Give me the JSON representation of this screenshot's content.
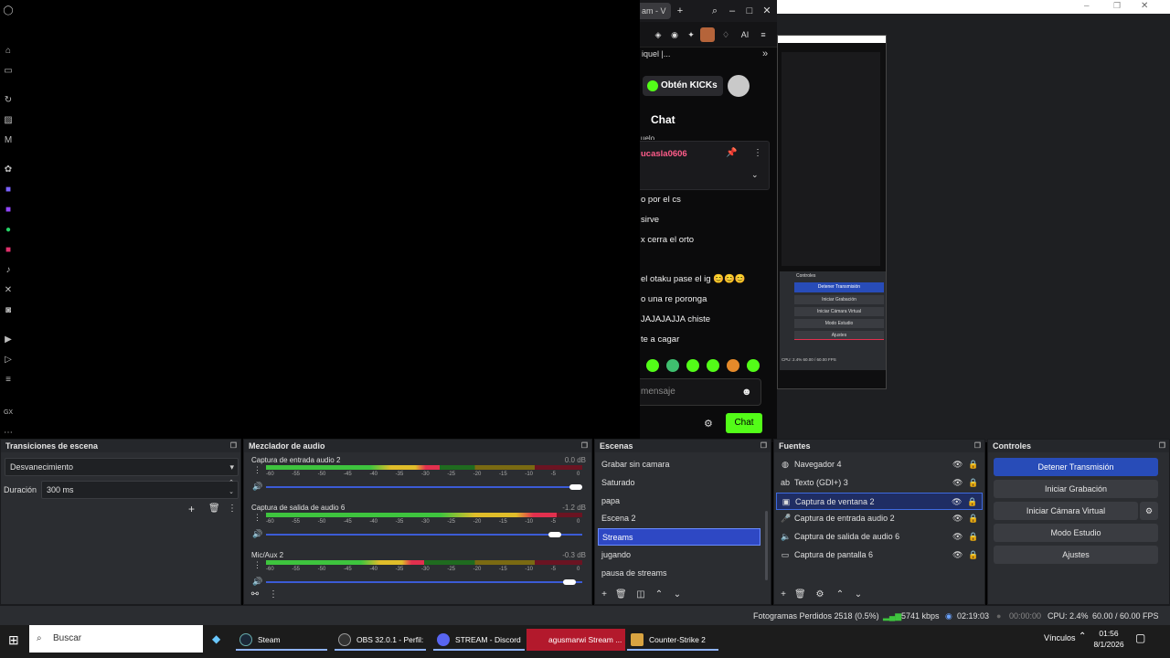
{
  "browser": {
    "tab_title": "am - V",
    "channel_header": "iquel |...",
    "kicks_button": "Obtén KICKs",
    "chat_title": "Chat",
    "partial_line": "uelo",
    "pinned_user": "ucasla0606",
    "messages": [
      "o por el cs",
      "sirve",
      "x cerra el orto",
      "el otaku pase el ig 😊😊😊",
      "o una re poronga",
      "JAJAJAJJA chiste",
      "te a cagar"
    ],
    "input_placeholder": "mensaje",
    "chat_send": "Chat",
    "toolbar_ai": "AI"
  },
  "preview": {
    "controles": "Controles",
    "btns": [
      "Detener Transmisión",
      "Iniciar Grabación",
      "Iniciar Cámara Virtual",
      "Modo Estudio",
      "Ajustes"
    ],
    "status": "CPU: 2.4%   60.00 / 60.00 FPS",
    "date": "01:56 8/1/2026",
    "vinculos": "Vínculos"
  },
  "transitions": {
    "title": "Transiciones de escena",
    "selected": "Desvanecimiento",
    "duration_label": "Duración",
    "duration_value": "300 ms"
  },
  "mixer": {
    "title": "Mezclador de audio",
    "scale": [
      "-60",
      "-55",
      "-50",
      "-45",
      "-40",
      "-35",
      "-30",
      "-25",
      "-20",
      "-15",
      "-10",
      "-5",
      "0"
    ],
    "tracks": [
      {
        "name": "Captura de entrada audio 2",
        "db": "0.0 dB",
        "level": 0.55,
        "volume": 1.0
      },
      {
        "name": "Captura de salida de audio 6",
        "db": "-1.2 dB",
        "level": 0.92,
        "volume": 0.93
      },
      {
        "name": "Mic/Aux 2",
        "db": "-0.3 dB",
        "level": 0.5,
        "volume": 0.98
      }
    ]
  },
  "scenes": {
    "title": "Escenas",
    "items": [
      "Grabar sin camara",
      "Saturado",
      "papa",
      "Escena 2",
      "Streams",
      "jugando",
      "pausa de streams"
    ],
    "selected_index": 4
  },
  "sources": {
    "title": "Fuentes",
    "items": [
      {
        "name": "Navegador 4",
        "icon": "globe-icon"
      },
      {
        "name": "Texto (GDI+) 3",
        "icon": "text-icon"
      },
      {
        "name": "Captura de ventana 2",
        "icon": "window-icon"
      },
      {
        "name": "Captura de entrada audio 2",
        "icon": "mic-icon"
      },
      {
        "name": "Captura de salida de audio 6",
        "icon": "speaker-icon"
      },
      {
        "name": "Captura de pantalla 6",
        "icon": "monitor-icon"
      }
    ],
    "selected_index": 2
  },
  "controls": {
    "title": "Controles",
    "stop_stream": "Detener Transmisión",
    "start_recording": "Iniciar Grabación",
    "start_virtualcam": "Iniciar Cámara Virtual",
    "studio_mode": "Modo Estudio",
    "settings": "Ajustes"
  },
  "status": {
    "dropped": "Fotogramas Perdidos 2518 (0.5%)",
    "bitrate": "5741 kbps",
    "stream_time": "02:19:03",
    "rec_time": "00:00:00",
    "cpu": "CPU: 2.4%",
    "fps": "60.00 / 60.00 FPS"
  },
  "taskbar": {
    "search": "Buscar",
    "apps": [
      {
        "label": "Steam"
      },
      {
        "label": "OBS 32.0.1 - Perfil: ..."
      },
      {
        "label": "STREAM - Discord"
      },
      {
        "label": "agusmarwi Stream ..."
      },
      {
        "label": "Counter-Strike 2"
      }
    ],
    "tray_label": "Vínculos",
    "time": "01:56",
    "date": "8/1/2026"
  },
  "colors": {
    "kick_green": "#53fc18",
    "obs_blue": "#284cb8",
    "pinned_name": "#ff5c8a"
  }
}
